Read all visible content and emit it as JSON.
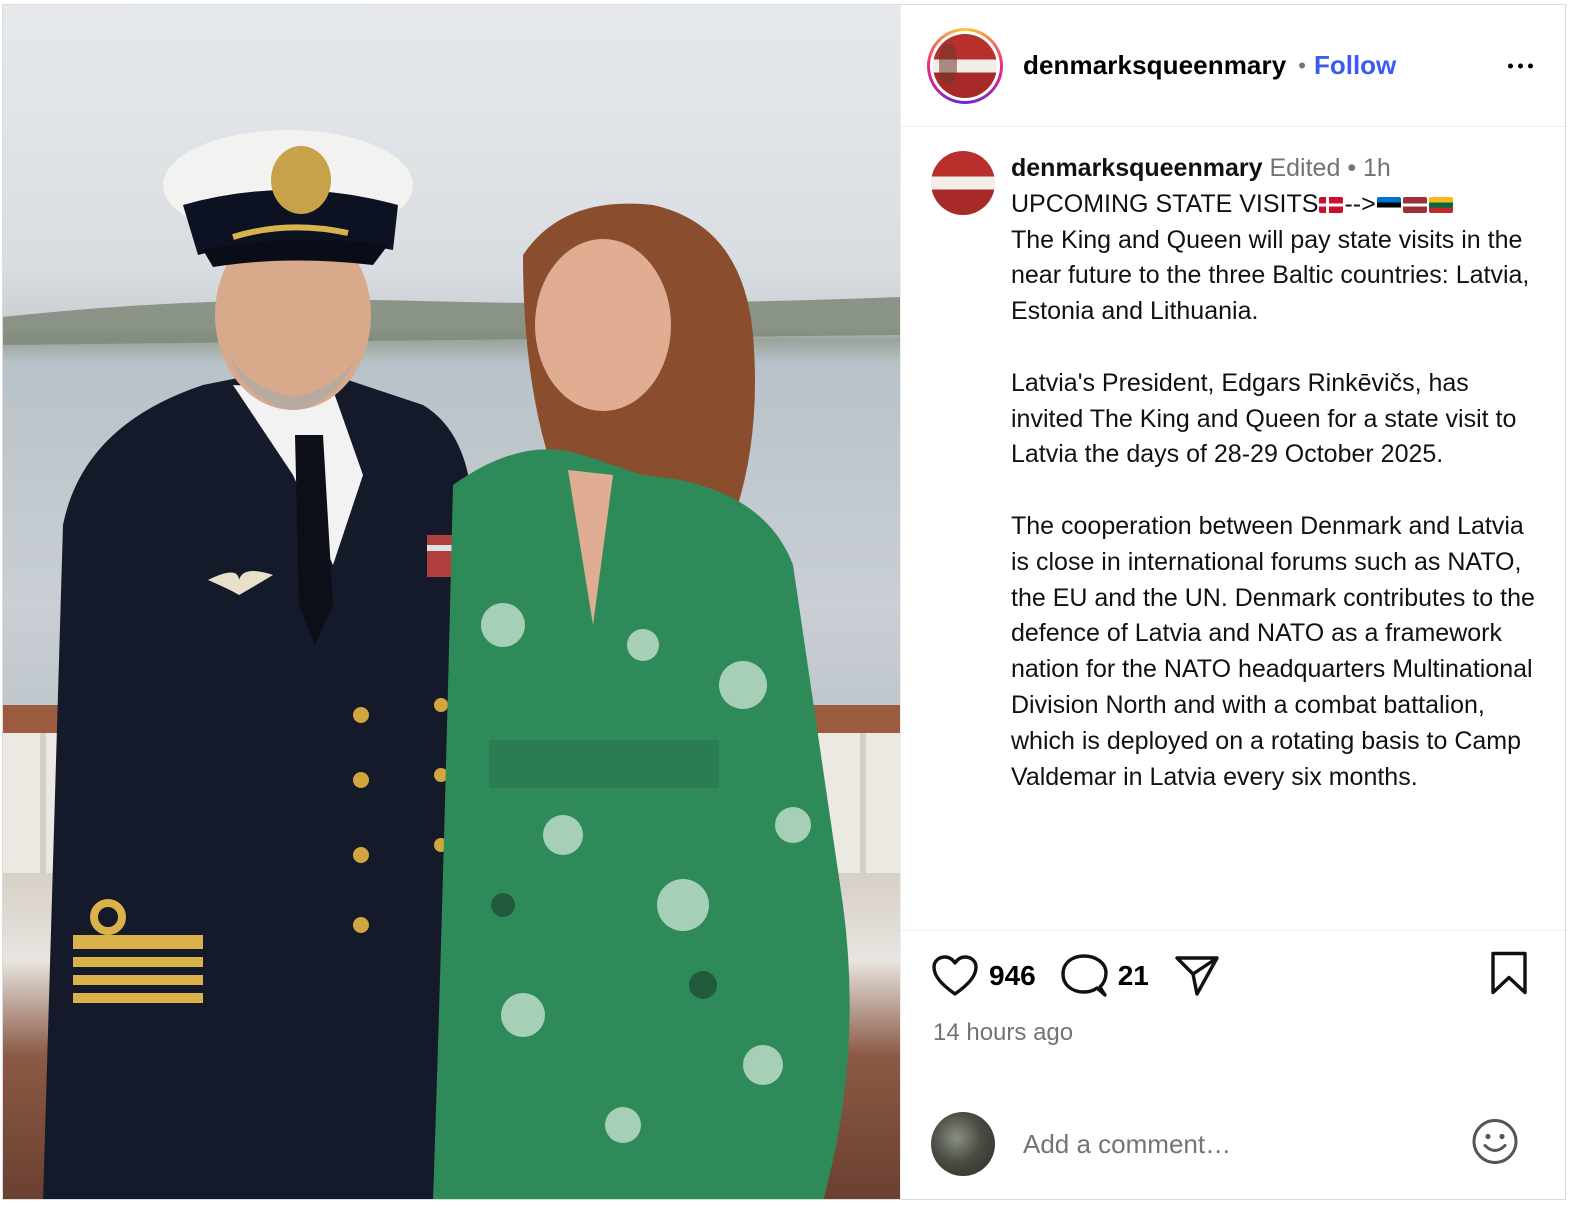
{
  "post": {
    "username": "denmarksqueenmary",
    "follow_label": "Follow",
    "header_separator": "•",
    "caption": {
      "username": "denmarksqueenmary",
      "edited": "Edited",
      "age": "1h",
      "title_prefix": "UPCOMING STATE VISITS",
      "arrow": "-->",
      "paragraphs": [
        "The King and Queen will pay state visits in the near future to the three Baltic countries: Latvia, Estonia and Lithuania.",
        "Latvia's President, Edgars Rinkēvičs, has invited The King and Queen for a state visit to Latvia the days of 28-29 October 2025.",
        "The cooperation between Denmark and Latvia is close in international forums such as NATO, the EU and the UN. Denmark contributes to the defence of Latvia and NATO as a framework nation for the NATO headquarters Multinational Division North and with a combat battalion, which is deployed on a rotating basis to Camp Valdemar in Latvia every six months."
      ]
    },
    "likes": "946",
    "comments": "21",
    "timestamp": "14 hours ago",
    "comment_placeholder": "Add a comment…",
    "icons": [
      "heart-icon",
      "comment-icon",
      "share-icon",
      "bookmark-icon",
      "emoji-icon",
      "more-icon"
    ],
    "colors": {
      "follow": "#3d5af1",
      "meta": "#737373",
      "border": "#dbdbdb"
    }
  }
}
